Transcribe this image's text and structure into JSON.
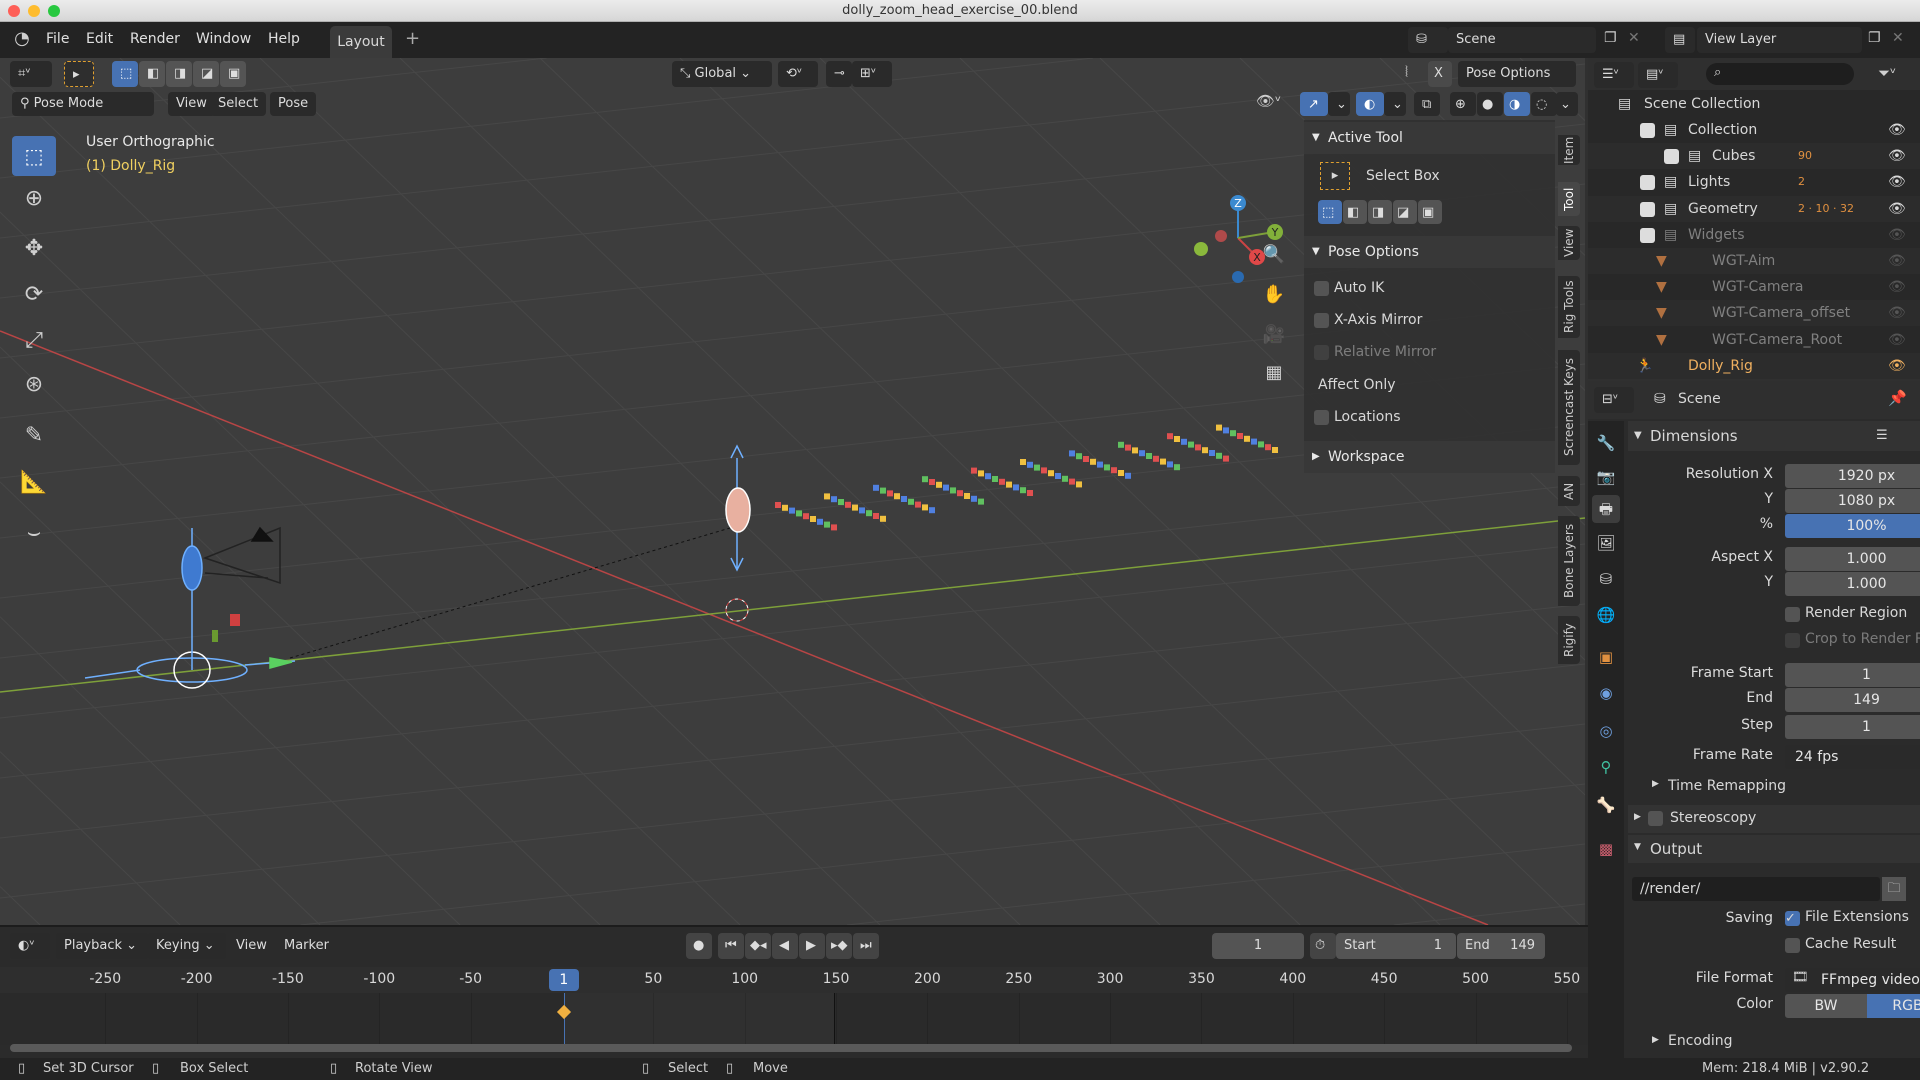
{
  "window": {
    "title": "dolly_zoom_head_exercise_00.blend"
  },
  "menu": [
    "File",
    "Edit",
    "Render",
    "Window",
    "Help"
  ],
  "workspace_tab": "Layout",
  "add_tab": "+",
  "scene_selector": "Scene",
  "view_layer": "View Layer",
  "viewport": {
    "transform_orientation": "Global",
    "pose_options": "Pose Options",
    "mirror_x": "X",
    "mode": "Pose Mode",
    "header_menus": [
      "View",
      "Select",
      "Pose"
    ],
    "view_name": "User Orthographic",
    "object_label": "(1) Dolly_Rig",
    "gizmo_axes": [
      "X",
      "Y",
      "Z"
    ],
    "colors": {
      "x_axis": "#b84545",
      "y_axis": "#7ea03a",
      "selected_text": "#f0d060"
    }
  },
  "npanel": {
    "active_tool_title": "Active Tool",
    "tool_name": "Select Box",
    "pose_options_title": "Pose Options",
    "options": [
      {
        "label": "Auto IK",
        "checked": false
      },
      {
        "label": "X-Axis Mirror",
        "checked": false
      },
      {
        "label": "Relative Mirror",
        "checked": false,
        "disabled": true
      }
    ],
    "affect_only": "Affect Only",
    "locations": {
      "label": "Locations",
      "checked": false
    },
    "workspace_title": "Workspace",
    "tabs": [
      "Item",
      "Tool",
      "View",
      "Rig Tools",
      "Screencast Keys",
      "AN",
      "Bone Layers",
      "Rigify"
    ],
    "active_tab": "Tool"
  },
  "outliner": {
    "search_placeholder": "",
    "root": "Scene Collection",
    "items": [
      {
        "label": "Collection",
        "depth": 0,
        "badge": ""
      },
      {
        "label": "Cubes",
        "depth": 1,
        "badge": "90"
      },
      {
        "label": "Lights",
        "depth": 0,
        "badge": "2"
      },
      {
        "label": "Geometry",
        "depth": 0,
        "badge": "2 · 10 · 32"
      },
      {
        "label": "Widgets",
        "depth": 0,
        "badge": "",
        "dim": true
      },
      {
        "label": "WGT-Aim",
        "depth": 1,
        "badge": "",
        "dim": true
      },
      {
        "label": "WGT-Camera",
        "depth": 1,
        "badge": "",
        "dim": true
      },
      {
        "label": "WGT-Camera_offset",
        "depth": 1,
        "badge": "",
        "dim": true
      },
      {
        "label": "WGT-Camera_Root",
        "depth": 1,
        "badge": "",
        "dim": true
      },
      {
        "label": "Dolly_Rig",
        "depth": 0,
        "badge": "",
        "active": true
      }
    ]
  },
  "properties": {
    "context": "Scene",
    "dimensions_title": "Dimensions",
    "resolution_x_label": "Resolution X",
    "resolution_x": "1920 px",
    "resolution_y_label": "Y",
    "resolution_y": "1080 px",
    "percent_label": "%",
    "percent": "100%",
    "aspect_x_label": "Aspect X",
    "aspect_x": "1.000",
    "aspect_y_label": "Y",
    "aspect_y": "1.000",
    "render_region": "Render Region",
    "crop": "Crop to Render Re...",
    "frame_start_label": "Frame Start",
    "frame_start": "1",
    "end_label": "End",
    "frame_end": "149",
    "step_label": "Step",
    "step": "1",
    "frame_rate_label": "Frame Rate",
    "frame_rate": "24 fps",
    "time_remapping": "Time Remapping",
    "stereoscopy": "Stereoscopy",
    "output_title": "Output",
    "output_path": "//render/",
    "saving_label": "Saving",
    "file_extensions": "File Extensions",
    "cache_result": "Cache Result",
    "file_format_label": "File Format",
    "file_format": "FFmpeg video",
    "color_label": "Color",
    "color_options": [
      "BW",
      "RGB"
    ],
    "color_selected": "RGB",
    "encoding": "Encoding"
  },
  "timeline": {
    "menus": [
      "Playback",
      "Keying",
      "View",
      "Marker"
    ],
    "current_frame": "1",
    "start_label": "Start",
    "start": "1",
    "end_label": "End",
    "end": "149",
    "ticks": [
      -250,
      -200,
      -150,
      -100,
      -50,
      50,
      100,
      150,
      200,
      250,
      300,
      350,
      400,
      450,
      500,
      550
    ],
    "playhead": "1"
  },
  "status": {
    "items": [
      "Set 3D Cursor",
      "Box Select",
      "Rotate View",
      "Select",
      "Move"
    ],
    "memory": "Mem: 218.4 MiB | v2.90.2"
  }
}
